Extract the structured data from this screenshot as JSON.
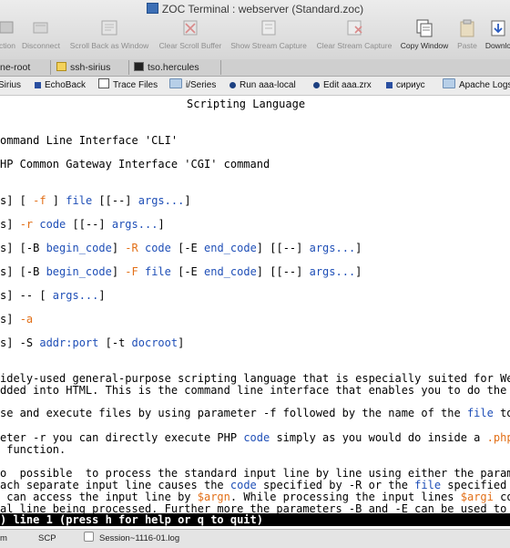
{
  "window": {
    "title": "ZOC Terminal : webserver (Standard.zoc)"
  },
  "toolbar": [
    {
      "label": "ction",
      "icon": "connection-icon",
      "enabled": false
    },
    {
      "label": "Disconnect",
      "icon": "disconnect-icon",
      "enabled": false
    },
    {
      "label": "Scroll Back as Window",
      "icon": "scrollback-icon",
      "enabled": false
    },
    {
      "label": "Clear Scroll Buffer",
      "icon": "clear-scroll-icon",
      "enabled": false
    },
    {
      "label": "Show Stream Capture",
      "icon": "show-capture-icon",
      "enabled": false
    },
    {
      "label": "Clear Stream Capture",
      "icon": "clear-capture-icon",
      "enabled": false
    },
    {
      "label": "Copy Window",
      "icon": "copy-window-icon",
      "enabled": true
    },
    {
      "label": "Paste",
      "icon": "paste-icon",
      "enabled": false
    },
    {
      "label": "Downlo",
      "icon": "download-icon",
      "enabled": true
    }
  ],
  "tabs": [
    {
      "label": "ne-root"
    },
    {
      "label": "ssh-sirius"
    },
    {
      "label": "tso.hercules"
    }
  ],
  "buttonbar": [
    {
      "label": "Sirius",
      "icon": "none"
    },
    {
      "label": "EchoBack",
      "icon": "square-icon"
    },
    {
      "label": "Trace Files",
      "icon": "document-icon"
    },
    {
      "label": "i/Series",
      "icon": "folder-icon"
    },
    {
      "label": "Run aaa-local",
      "icon": "dot-icon"
    },
    {
      "label": "Edit aaa.zrx",
      "icon": "dot-icon"
    },
    {
      "label": "сириус",
      "icon": "square-icon"
    },
    {
      "label": "Apache Logs",
      "icon": "folder-icon"
    }
  ],
  "terminal": {
    "heading": "Scripting Language",
    "cli_line": "ommand Line Interface 'CLI'",
    "cgi_line": "HP Common Gateway Interface 'CGI' command",
    "usage": [
      [
        [
          "s] [ ",
          ""
        ],
        [
          "-f",
          "orange"
        ],
        [
          " ] ",
          ""
        ],
        [
          "file",
          "blue"
        ],
        [
          " [[--] ",
          ""
        ],
        [
          "args...",
          "blue"
        ],
        [
          "]",
          ""
        ]
      ],
      [
        [
          "s] ",
          ""
        ],
        [
          "-r",
          "orange"
        ],
        [
          " ",
          ""
        ],
        [
          "code",
          "blue"
        ],
        [
          " [[--] ",
          ""
        ],
        [
          "args...",
          "blue"
        ],
        [
          "]",
          ""
        ]
      ],
      [
        [
          "s] [-B ",
          ""
        ],
        [
          "begin_code",
          "blue"
        ],
        [
          "] ",
          ""
        ],
        [
          "-R",
          "orange"
        ],
        [
          " ",
          ""
        ],
        [
          "code",
          "blue"
        ],
        [
          " [-E ",
          ""
        ],
        [
          "end_code",
          "blue"
        ],
        [
          "] [[--] ",
          ""
        ],
        [
          "args...",
          "blue"
        ],
        [
          "]",
          ""
        ]
      ],
      [
        [
          "s] [-B ",
          ""
        ],
        [
          "begin_code",
          "blue"
        ],
        [
          "] ",
          ""
        ],
        [
          "-F",
          "orange"
        ],
        [
          " ",
          ""
        ],
        [
          "file",
          "blue"
        ],
        [
          " [-E ",
          ""
        ],
        [
          "end_code",
          "blue"
        ],
        [
          "] [[--] ",
          ""
        ],
        [
          "args...",
          "blue"
        ],
        [
          "]",
          ""
        ]
      ],
      [
        [
          "s] -- [ ",
          ""
        ],
        [
          "args...",
          "blue"
        ],
        [
          "]",
          ""
        ]
      ],
      [
        [
          "s] ",
          ""
        ],
        [
          "-a",
          "orange"
        ]
      ],
      [
        [
          "s] -S ",
          ""
        ],
        [
          "addr:port",
          "blue"
        ],
        [
          " [-t ",
          ""
        ],
        [
          "docroot",
          "blue"
        ],
        [
          "]",
          ""
        ]
      ]
    ],
    "para1": [
      [
        [
          "idely-used general-purpose scripting language that is especially suited for Web de",
          ""
        ]
      ],
      [
        [
          "dded into HTML. This is the command line interface that enables you to do the fol",
          ""
        ]
      ]
    ],
    "para2": [
      [
        [
          "se and execute files by using parameter -f followed by the name of the ",
          ""
        ],
        [
          "file",
          "blue"
        ],
        [
          " to be",
          ""
        ]
      ]
    ],
    "para3": [
      [
        [
          "eter -r you can directly execute PHP ",
          ""
        ],
        [
          "code",
          "blue"
        ],
        [
          " simply as you would do inside a ",
          ""
        ],
        [
          ".php",
          "orange"
        ],
        [
          " fil",
          ""
        ]
      ],
      [
        [
          " function.",
          ""
        ]
      ]
    ],
    "para4": [
      [
        [
          "o  possible  to process the standard input line by line using either the parameter",
          ""
        ]
      ],
      [
        [
          "ach separate input line causes the ",
          ""
        ],
        [
          "code",
          "blue"
        ],
        [
          " specified by -R or the ",
          ""
        ],
        [
          "file",
          "blue"
        ],
        [
          " specified by -",
          ""
        ]
      ],
      [
        [
          " can access the input line by ",
          ""
        ],
        [
          "$argn",
          "orange"
        ],
        [
          ". While processing the input lines ",
          ""
        ],
        [
          "$argi",
          "orange"
        ],
        [
          " conta",
          ""
        ]
      ],
      [
        [
          "al line being processed. Further more the parameters -B and -E can be used to exec",
          ""
        ]
      ]
    ],
    "status_line": ") line 1 (press h for help or q to quit)"
  },
  "statusbar": {
    "left": "m",
    "protocol": "SCP",
    "log_checked": false,
    "log_file": "Session~1116-01.log"
  }
}
